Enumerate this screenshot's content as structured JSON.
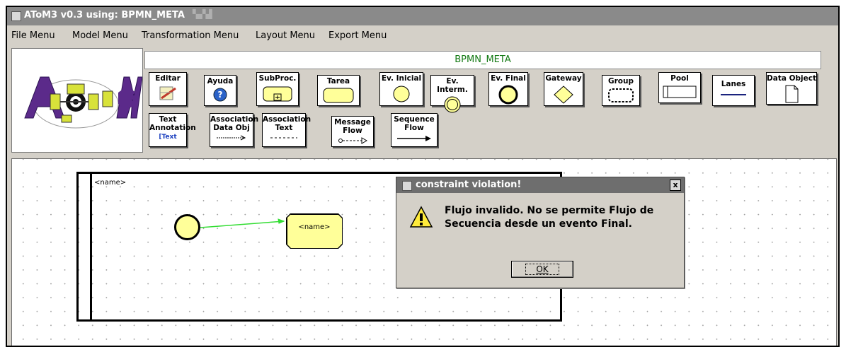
{
  "window": {
    "title": "AToM3 v0.3 using: BPMN_META",
    "title_decoration": "▚▞▟"
  },
  "menu": {
    "items": [
      "File Menu",
      "Model Menu",
      "Transformation Menu",
      "Layout Menu",
      "Export Menu"
    ]
  },
  "toolbar": {
    "model_name": "BPMN_META",
    "model_name_color": "#147a14",
    "buttons": {
      "editar": "Editar",
      "ayuda": "Ayuda",
      "subproc": "SubProc.",
      "tarea": "Tarea",
      "ev_inicial": "Ev. Inicial",
      "ev_interm": "Ev. Interm.",
      "ev_final": "Ev. Final",
      "gateway": "Gateway",
      "group": "Group",
      "pool": "Pool",
      "lanes": "Lanes",
      "data_object": "Data Object",
      "text_annotation_1": "Text",
      "text_annotation_2": "Annotation",
      "text_annotation_icon": "Text",
      "assoc_data_1": "Association",
      "assoc_data_2": "Data Obj",
      "assoc_text_1": "Association",
      "assoc_text_2": "Text",
      "message_flow_1": "Message",
      "message_flow_2": "Flow",
      "sequence_flow_1": "Sequence",
      "sequence_flow_2": "Flow"
    }
  },
  "canvas": {
    "pool_name": "<name>",
    "task_name": "<name>",
    "element_fill": "#ffff99",
    "flow_color": "#33dd33"
  },
  "dialog": {
    "title": "constraint violation!",
    "message": "Flujo invalido. No se permite Flujo de Secuencia desde un evento Final.",
    "ok_label": "OK",
    "close_label": "x"
  }
}
